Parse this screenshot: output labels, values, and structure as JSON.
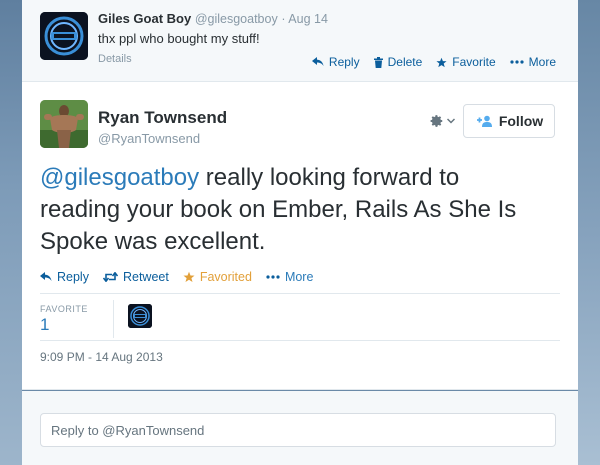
{
  "parent_tweet": {
    "author_name": "Giles Goat Boy",
    "author_handle": "@gilesgoatboy",
    "date": "Aug 14",
    "text": "thx ppl who bought my stuff!",
    "details_label": "Details",
    "actions": {
      "reply": "Reply",
      "delete": "Delete",
      "favorite": "Favorite",
      "more": "More"
    }
  },
  "main_tweet": {
    "author_name": "Ryan Townsend",
    "author_handle": "@RyanTownsend",
    "follow_label": "Follow",
    "mention": "@gilesgoatboy",
    "text_line1_rest": " really looking forward to",
    "text_line2": "reading your book on Ember, Rails As She Is",
    "text_line3": "Spoke was excellent.",
    "actions": {
      "reply": "Reply",
      "retweet": "Retweet",
      "favorited": "Favorited",
      "more": "More"
    },
    "stats": {
      "favorite_label": "FAVORITE",
      "favorite_count": "1"
    },
    "timestamp": "9:09 PM - 14 Aug 2013"
  },
  "reply_box": {
    "placeholder": "Reply to @RyanTownsend"
  },
  "colors": {
    "link": "#2b7bb9",
    "action": "#0b5e9c",
    "favorited": "#e2a03a",
    "muted": "#8899a6"
  }
}
